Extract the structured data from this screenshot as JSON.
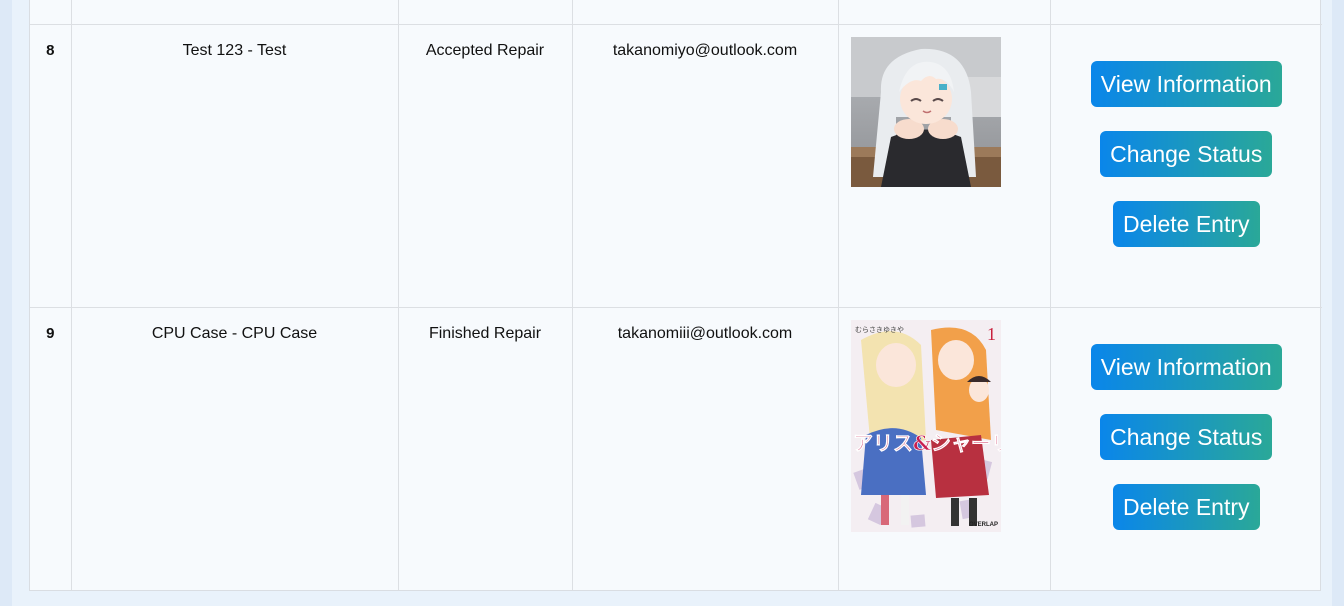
{
  "rows": [
    {
      "index": "8",
      "item": "Test 123 - Test",
      "status": "Accepted Repair",
      "email": "takanomiyo@outlook.com"
    },
    {
      "index": "9",
      "item": "CPU Case - CPU Case",
      "status": "Finished Repair",
      "email": "takanomiii@outlook.com",
      "image_text": {
        "volume": "1",
        "title": "アリス&シャーリー",
        "author": "むらさきゆきや",
        "publisher": "OVERLAP"
      }
    }
  ],
  "actions": {
    "view_label": "View Information",
    "change_label": "Change Status",
    "delete_label": "Delete Entry"
  },
  "colors": {
    "button_start": "#0a86ea",
    "button_end": "#2aa898",
    "table_bg": "#f7fafd",
    "page_bg": "#e9f2fb"
  }
}
